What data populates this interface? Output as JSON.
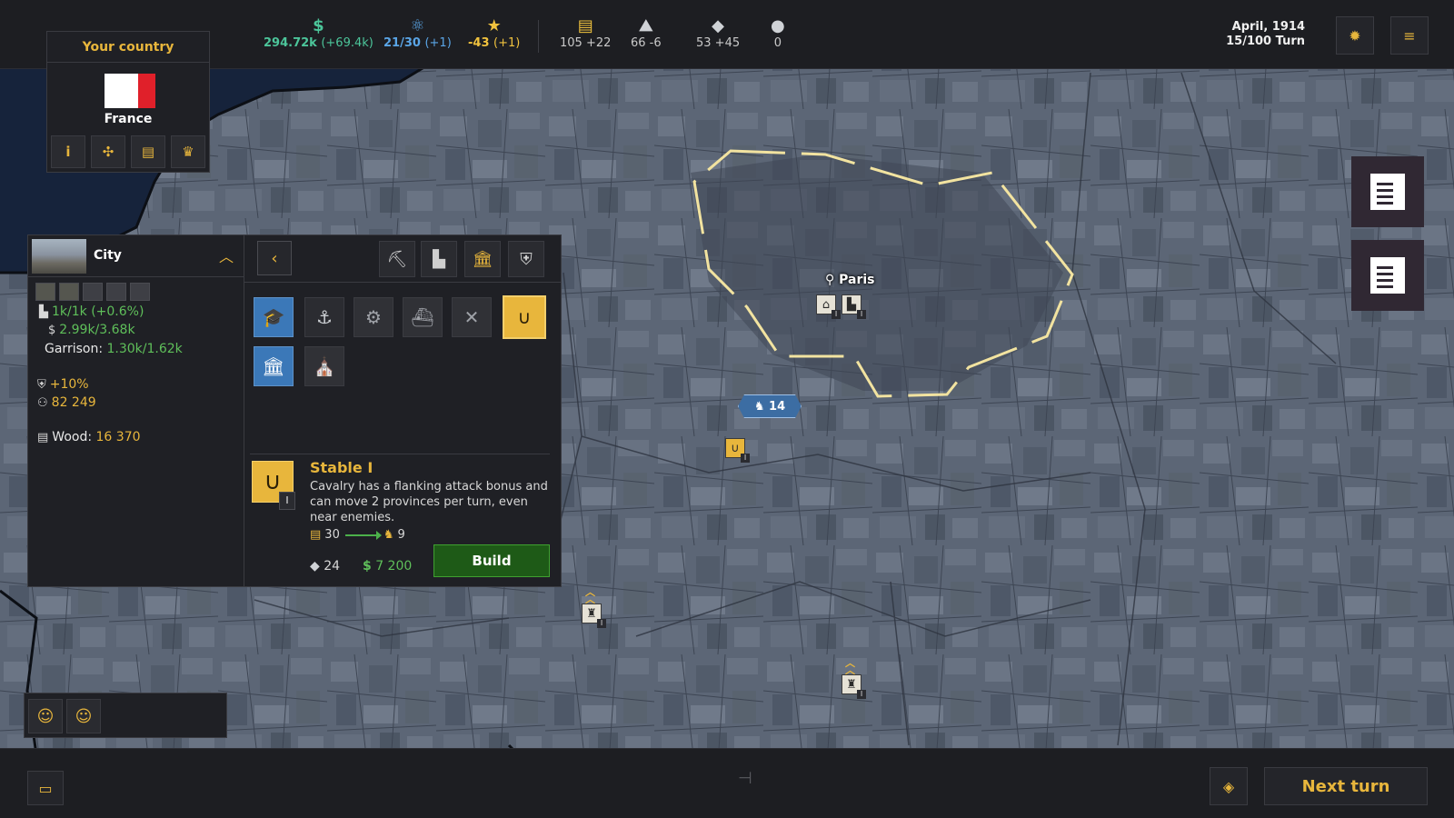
{
  "topbar": {
    "resources": [
      {
        "icon": "dollar-icon",
        "glyph": "$",
        "value": "294.72k",
        "delta": "(+69.4k)",
        "color": "#4cc59a"
      },
      {
        "icon": "atom-icon",
        "glyph": "⚛",
        "value": "21/30",
        "delta": "(+1)",
        "color": "#5aa5e6"
      },
      {
        "icon": "star-icon",
        "glyph": "★",
        "value": "-43",
        "delta": "(+1)",
        "color": "#f0c23e"
      }
    ],
    "materials": [
      {
        "icon": "wood-icon",
        "glyph": "🪵",
        "value": "105 +22"
      },
      {
        "icon": "ore-icon",
        "glyph": "⛏",
        "value": "66 -6"
      },
      {
        "icon": "steel-icon",
        "glyph": "◆",
        "value": "53 +45"
      },
      {
        "icon": "oil-icon",
        "glyph": "💧",
        "value": "0"
      }
    ],
    "date": "April, 1914",
    "turn": "15/100 Turn"
  },
  "country": {
    "header": "Your country",
    "name": "France",
    "flag_colors": [
      "#ffffff",
      "#ffffff",
      "#e0202a"
    ],
    "buttons": [
      "info-icon",
      "network-icon",
      "document-icon",
      "trophy-icon"
    ]
  },
  "city": {
    "title": "City",
    "population_industry": "1k/1k (+0.6%)",
    "income": "2.99k/3.68k",
    "garrison_label": "Garrison:",
    "garrison_value": "1.30k/1.62k",
    "defense": "+10%",
    "population": "82 249",
    "resource_label": "Wood:",
    "resource_value": "16 370"
  },
  "buildings": {
    "selected": {
      "title": "Stable I",
      "level": "I",
      "description": "Cavalry has a flanking attack bonus and can move 2 provinces per turn, even near enemies.",
      "convert_from": "30",
      "convert_to": "9",
      "cost_steel": "24",
      "cost_money": "7 200",
      "build_label": "Build"
    }
  },
  "map": {
    "city_name": "Paris",
    "army_count": "14"
  },
  "bottombar": {
    "next_turn": "Next turn"
  },
  "colors": {
    "accent": "#e8b63c",
    "positive": "#5fbf5a",
    "build": "#1e5a17",
    "ocean": "#16233b"
  }
}
